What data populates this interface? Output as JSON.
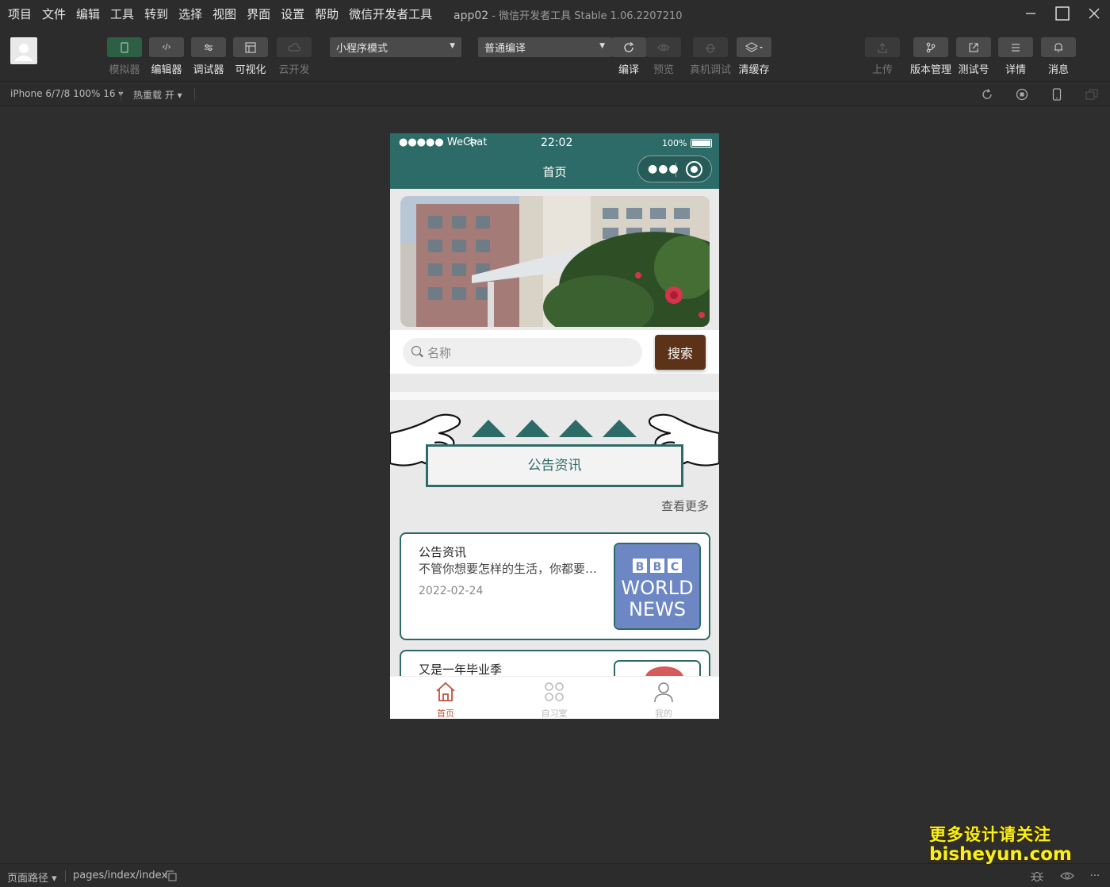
{
  "menu": [
    "项目",
    "文件",
    "编辑",
    "工具",
    "转到",
    "选择",
    "视图",
    "界面",
    "设置",
    "帮助",
    "微信开发者工具"
  ],
  "window": {
    "app": "app02",
    "title": " - 微信开发者工具 Stable 1.06.2207210"
  },
  "toolbar": {
    "simulator": "模拟器",
    "editor": "编辑器",
    "debugger": "调试器",
    "visual": "可视化",
    "cloud": "云开发",
    "mode_select": "小程序模式",
    "compile_select": "普通编译",
    "compile": "编译",
    "preview": "预览",
    "remote_debug": "真机调试",
    "clear_cache": "清缓存",
    "upload": "上传",
    "version": "版本管理",
    "test_account": "测试号",
    "details": "详情",
    "messages": "消息"
  },
  "subbar": {
    "device": "iPhone 6/7/8 100% 16 ▾",
    "hot_reload": "热重载 开 ▾"
  },
  "phone": {
    "carrier": "●●●●● WeChat",
    "time": "22:02",
    "battery": "100%",
    "nav_title": "首页",
    "search_placeholder": "名称",
    "search_button": "搜索",
    "section_title": "公告资讯",
    "more": "查看更多",
    "cards": [
      {
        "title": "公告资讯",
        "desc": "不管你想要怎样的生活，你都要…",
        "date": "2022-02-24",
        "thumb_text": [
          "BBC",
          "WORLD",
          "NEWS"
        ]
      },
      {
        "title": "又是一年毕业季"
      }
    ],
    "tabs": [
      "首页",
      "自习室",
      "我的"
    ]
  },
  "bottom": {
    "path_label": "页面路径 ▾",
    "path": "pages/index/index"
  },
  "watermark": {
    "line1": "更多设计请关注",
    "line2": "bisheyun.com"
  },
  "colors": {
    "theme": "#2d6b68",
    "button": "#5c3318",
    "active_tab": "#c0513a"
  }
}
